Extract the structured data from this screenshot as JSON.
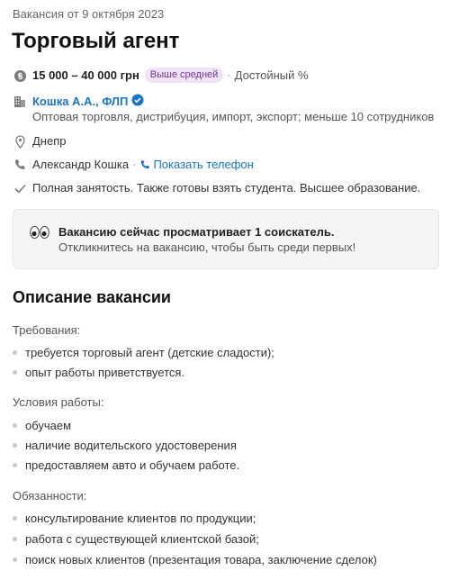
{
  "header": {
    "date": "Вакансия от 9 октября 2023",
    "title": "Торговый агент"
  },
  "salary": {
    "amount": "15 000 – 40 000 грн",
    "badge": "Выше средней",
    "separator": "·",
    "note": "Достойный %"
  },
  "company": {
    "name": "Кошка А.А., ФЛП",
    "description": "Оптовая торговля, дистрибуция, импорт, экспорт; меньше 10 сотрудников"
  },
  "location": {
    "city": "Днепр"
  },
  "contact": {
    "name": "Александр Кошка",
    "separator": "·",
    "phone_link": "Показать телефон"
  },
  "conditions": {
    "text": "Полная занятость. Также готовы взять студента. Высшее образование."
  },
  "notice": {
    "title": "Вакансию сейчас просматривает 1 соискатель.",
    "subtitle": "Откликнитесь на вакансию, чтобы быть среди первых!"
  },
  "description": {
    "heading": "Описание вакансии",
    "sections": [
      {
        "title": "Требования:",
        "items": [
          "требуется торговый агент (детские сладости);",
          "опыт работы приветствуется."
        ]
      },
      {
        "title": "Условия работы:",
        "items": [
          "обучаем",
          "наличие водительского удостоверения",
          "предоставляем авто и обучаем работе."
        ]
      },
      {
        "title": "Обязанности:",
        "items": [
          "консультирование клиентов по продукции;",
          "работа с существующей клиентской базой;",
          "поиск новых клиентов (презентация товара, заключение сделок)"
        ]
      }
    ]
  },
  "colors": {
    "link": "#1b73c4",
    "badge_bg": "#f0e3f6",
    "badge_text": "#6b3a8c",
    "notice_bg": "#f4f5f6"
  },
  "icons": [
    "currency-icon",
    "building-icon",
    "verified-icon",
    "location-pin-icon",
    "phone-icon",
    "phone-link-icon",
    "checkmark-icon",
    "eyes-icon"
  ]
}
